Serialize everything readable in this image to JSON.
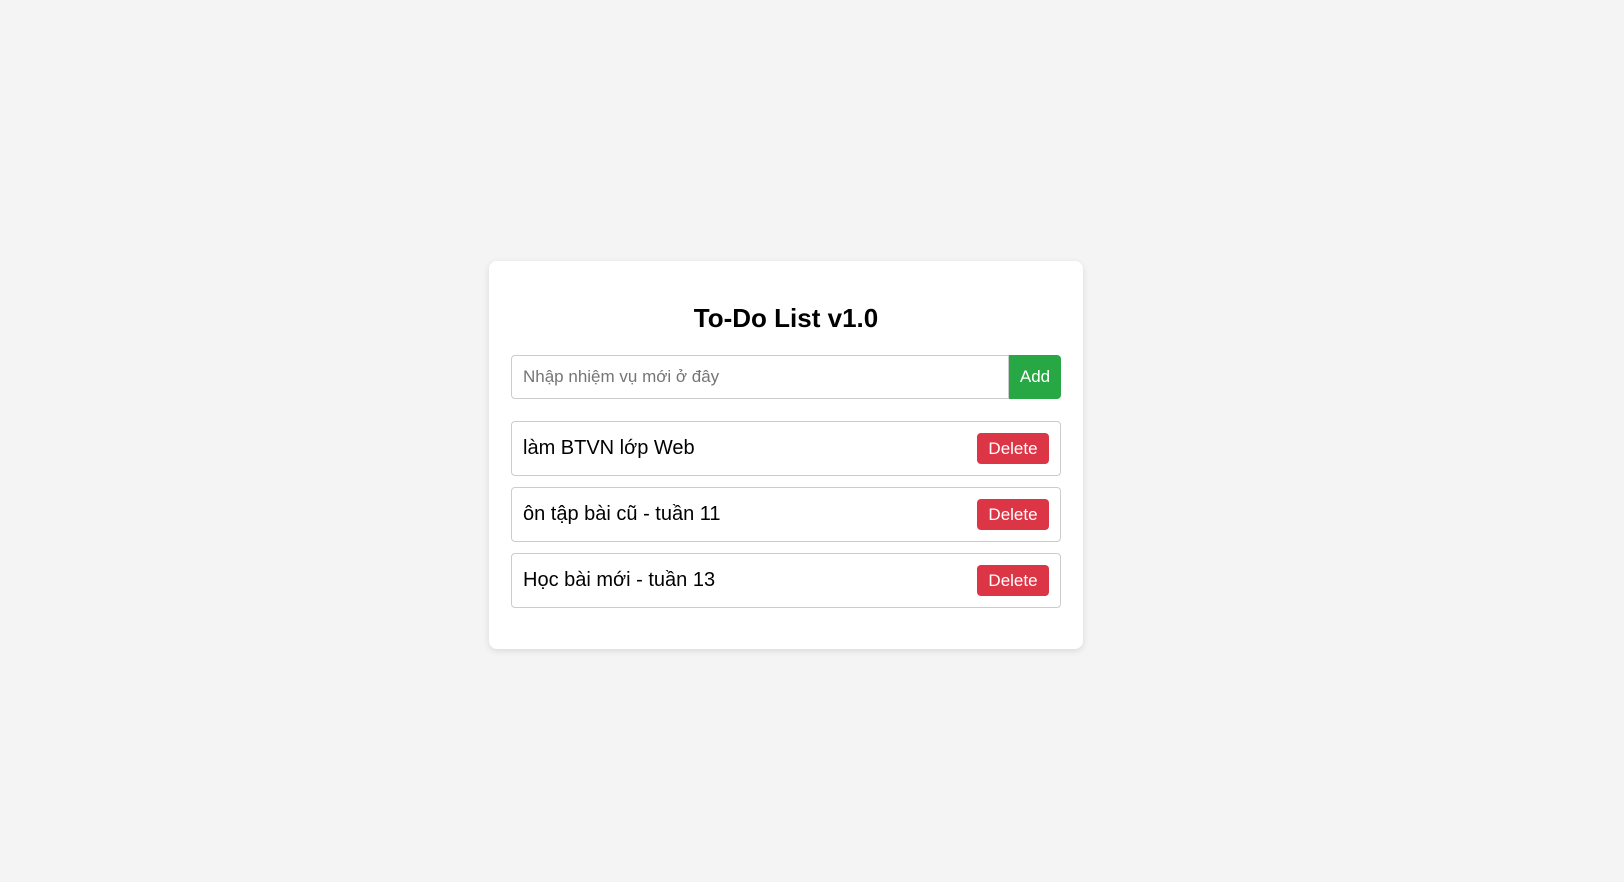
{
  "app": {
    "title": "To-Do List v1.0"
  },
  "input": {
    "value": "",
    "placeholder": "Nhập nhiệm vụ mới ở đây"
  },
  "add_button": {
    "label": "Add"
  },
  "tasks": [
    {
      "text": "làm BTVN lớp Web",
      "delete_label": "Delete"
    },
    {
      "text": "ôn tập bài cũ - tuần 11",
      "delete_label": "Delete"
    },
    {
      "text": "Học bài mới - tuần 13",
      "delete_label": "Delete"
    }
  ],
  "colors": {
    "page_background": "#f4f4f4",
    "card_background": "#ffffff",
    "add_button": "#28a745",
    "delete_button": "#dc3545",
    "border": "#cccccc"
  }
}
